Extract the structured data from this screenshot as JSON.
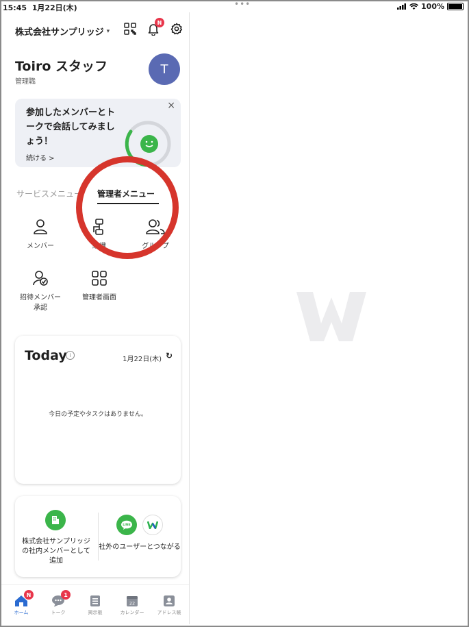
{
  "status_bar": {
    "time": "15:45",
    "date": "1月22日(木)",
    "battery": "100%"
  },
  "header": {
    "company": "株式会社サンプリッジ",
    "caret": "▾",
    "bell_badge": "N"
  },
  "profile": {
    "name": "Toiro スタッフ",
    "role": "管理職",
    "avatar_initial": "T"
  },
  "promo": {
    "text": "参加したメンバーとトークで会話してみましょう！",
    "link": "続ける >",
    "close": "×"
  },
  "tabs": {
    "service": "サービスメニュー",
    "admin": "管理者メニュー"
  },
  "admin_menu": [
    {
      "label": "メンバー",
      "icon": "member-icon"
    },
    {
      "label": "組織",
      "icon": "organization-icon"
    },
    {
      "label": "グループ",
      "icon": "group-icon"
    },
    {
      "label": "招待メンバー承認",
      "icon": "invite-approve-icon"
    },
    {
      "label": "管理者画面",
      "icon": "admin-dashboard-icon"
    }
  ],
  "today": {
    "title": "Today",
    "date": "1月22日(木)",
    "empty_message": "今日の予定やタスクはありません。"
  },
  "connect": {
    "internal": "株式会社サンプリッジの社内メンバーとして追加",
    "external": "社外のユーザーとつながる"
  },
  "tabbar": [
    {
      "label": "ホーム",
      "icon": "home-icon",
      "badge": "N",
      "active": true
    },
    {
      "label": "トーク",
      "icon": "talk-icon",
      "badge": "1",
      "active": false
    },
    {
      "label": "掲示板",
      "icon": "bulletin-icon",
      "badge": "",
      "active": false
    },
    {
      "label": "カレンダー",
      "icon": "calendar-icon",
      "badge": "",
      "day": "22",
      "active": false
    },
    {
      "label": "アドレス帳",
      "icon": "address-book-icon",
      "badge": "",
      "active": false
    }
  ],
  "colors": {
    "accent": "#2a6bd1",
    "green": "#3bb54a",
    "badge_red": "#e8364b",
    "annotation_red": "#d6352c",
    "avatar": "#5a6ab3"
  }
}
